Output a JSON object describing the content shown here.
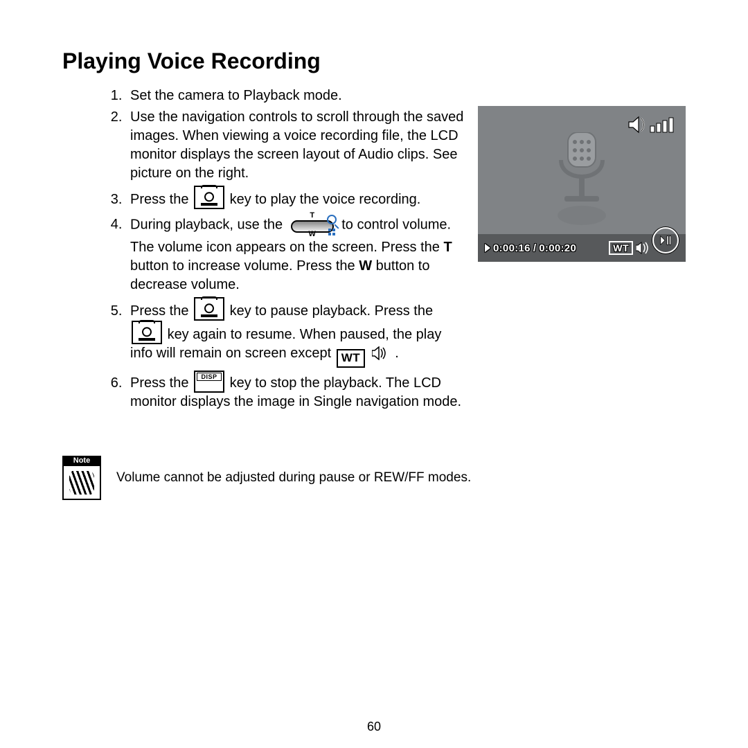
{
  "title": "Playing Voice Recording",
  "steps": {
    "s1": "Set the camera to Playback mode.",
    "s2a": "Use the navigation controls to scroll through the saved images. When viewing a voice recording file, the LCD monitor displays the screen layout of Audio clips. See picture on the right.",
    "s3a": "Press the",
    "s3b": " key to play the voice recording.",
    "s4a": "During playback, use the ",
    "s4b": " to control volume. The volume icon appears on the screen. Press the ",
    "s4c": "T",
    "s4d": " button to increase volume. Press the ",
    "s4e": "W",
    "s4f": " button to decrease volume.",
    "s5a": "Press the",
    "s5b": " key to pause playback. Press the",
    "s5c": " key again to resume. When paused, the play info will remain on screen except ",
    "s5d": ".",
    "s6a": "Press the",
    "s6b": " key to stop the playback. The LCD monitor displays the image in Single navigation mode."
  },
  "inline": {
    "wt": "WT",
    "disp": "DISP"
  },
  "lcd": {
    "elapsed": "0:00:16",
    "sep": " / ",
    "total": "0:00:20",
    "wt": "WT"
  },
  "note": {
    "label": "Note",
    "text": "Volume cannot be adjusted during pause or REW/FF modes."
  },
  "page_number": "60"
}
